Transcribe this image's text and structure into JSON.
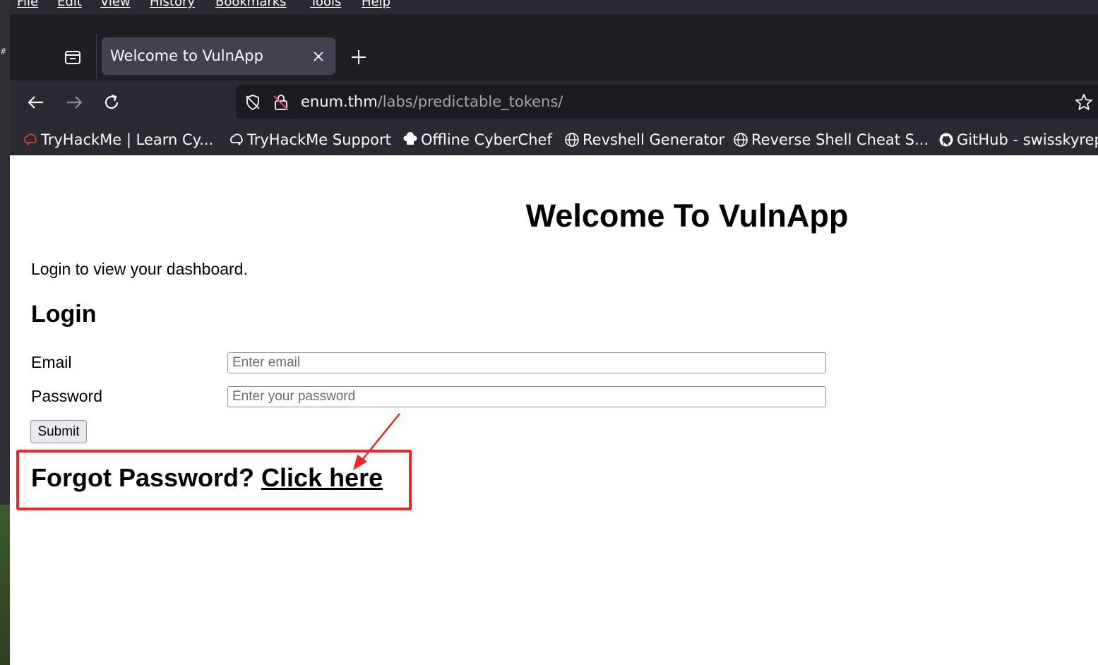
{
  "menubar": {
    "items": [
      "File",
      "Edit",
      "View",
      "History",
      "Bookmarks",
      "Tools",
      "Help"
    ]
  },
  "tab": {
    "title": "Welcome to VulnApp",
    "close_icon": "close-icon"
  },
  "navbar": {
    "back_icon": "back-arrow-icon",
    "forward_icon": "forward-arrow-icon",
    "reload_icon": "reload-icon"
  },
  "urlbar": {
    "host": "enum.thm",
    "path": "/labs/predictable_tokens/"
  },
  "bookmarks": [
    {
      "label": "TryHackMe | Learn Cy...",
      "icon": "tryhackme-icon"
    },
    {
      "label": "TryHackMe Support",
      "icon": "cloud-icon"
    },
    {
      "label": "Offline CyberChef",
      "icon": "chef-hat-icon"
    },
    {
      "label": "Revshell Generator",
      "icon": "globe-icon"
    },
    {
      "label": "Reverse Shell Cheat S...",
      "icon": "globe-icon"
    },
    {
      "label": "GitHub - swisskyrep",
      "icon": "github-icon"
    }
  ],
  "page": {
    "title": "Welcome To VulnApp",
    "intro": "Login to view your dashboard.",
    "login_heading": "Login",
    "email_label": "Email",
    "email_placeholder": "Enter email",
    "password_label": "Password",
    "password_placeholder": "Enter your password",
    "submit_label": "Submit",
    "forgot_text": "Forgot Password?",
    "forgot_link": "Click here"
  },
  "colors": {
    "annotation": "#f02525",
    "chrome_dark": "#2b2a33",
    "tab_active": "#42414d"
  }
}
